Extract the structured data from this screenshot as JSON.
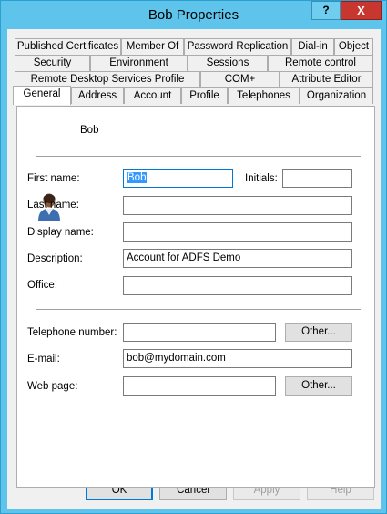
{
  "window": {
    "title": "Bob Properties",
    "help_glyph": "?",
    "close_glyph": "X"
  },
  "tabs": {
    "row1": [
      "Published Certificates",
      "Member Of",
      "Password Replication",
      "Dial-in",
      "Object"
    ],
    "row2": [
      "Security",
      "Environment",
      "Sessions",
      "Remote control"
    ],
    "row3": [
      "Remote Desktop Services Profile",
      "COM+",
      "Attribute Editor"
    ],
    "row4": [
      "General",
      "Address",
      "Account",
      "Profile",
      "Telephones",
      "Organization"
    ],
    "active": "General"
  },
  "general": {
    "display_name": "Bob",
    "labels": {
      "first_name": "First name:",
      "initials": "Initials:",
      "last_name": "Last name:",
      "display_name": "Display name:",
      "description": "Description:",
      "office": "Office:",
      "telephone": "Telephone number:",
      "email": "E-mail:",
      "web_page": "Web page:"
    },
    "values": {
      "first_name": "Bob",
      "initials": "",
      "last_name": "",
      "display_name": "",
      "description": "Account for ADFS Demo",
      "office": "",
      "telephone": "",
      "email": "bob@mydomain.com",
      "web_page": ""
    },
    "other_label": "Other..."
  },
  "footer": {
    "ok": "OK",
    "cancel": "Cancel",
    "apply": "Apply",
    "help": "Help"
  },
  "colors": {
    "title_bar": "#5ec4ec",
    "close_button": "#c7372f",
    "selection": "#3399ff"
  },
  "icons": [
    "user-icon",
    "help-icon",
    "close-icon"
  ]
}
